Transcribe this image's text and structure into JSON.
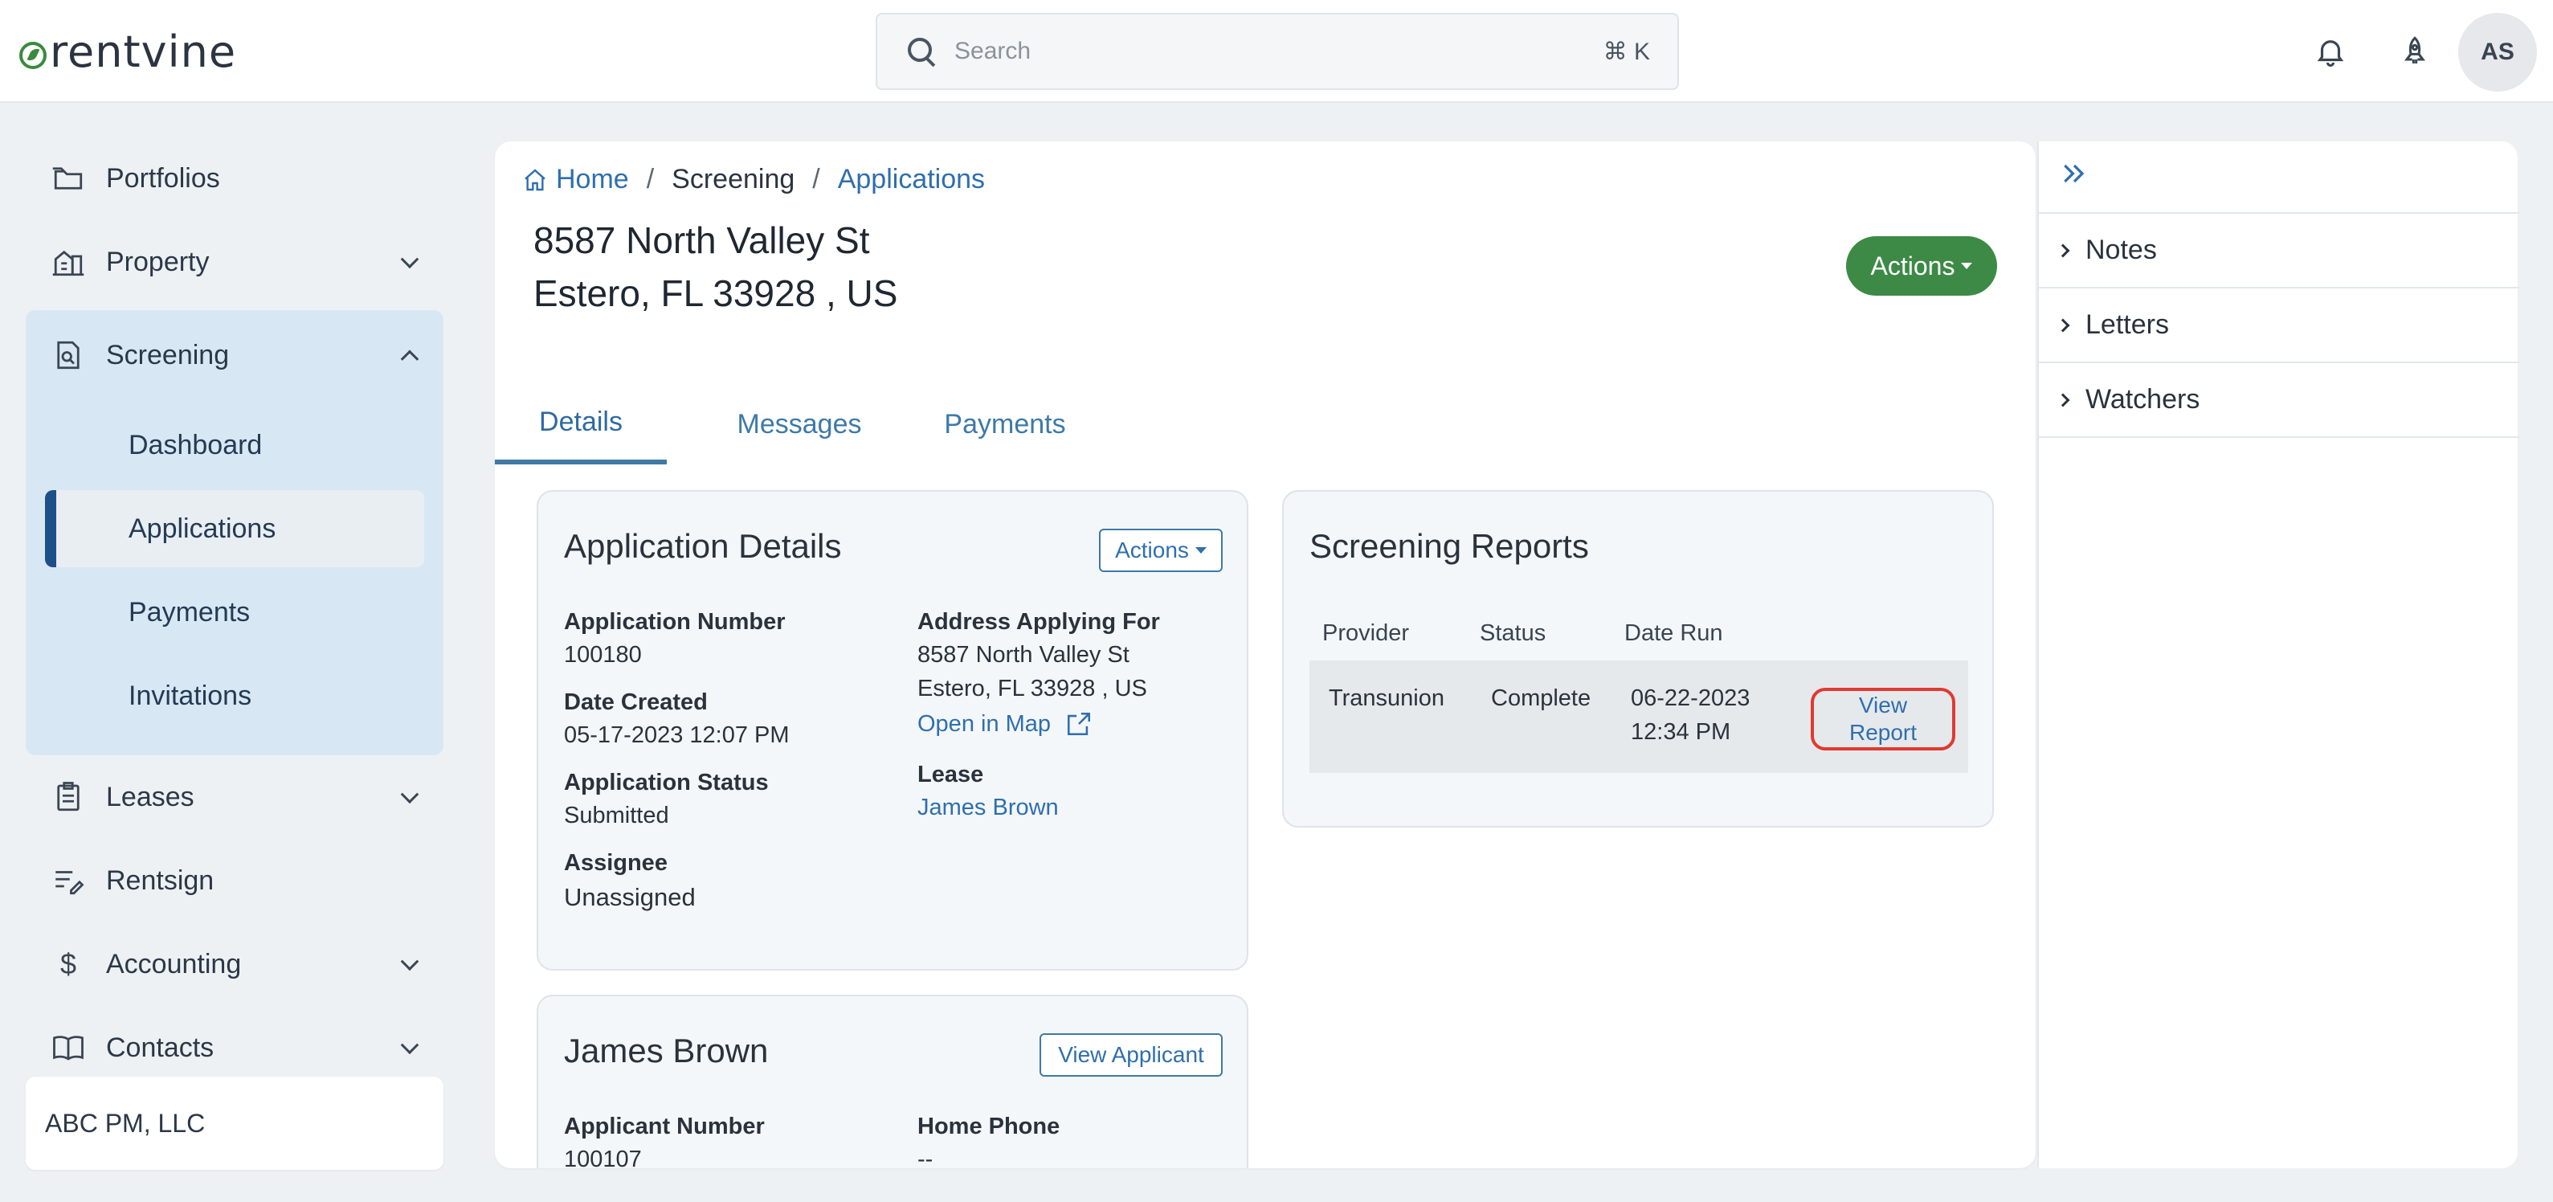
{
  "brand": {
    "logo_text": "rentvine",
    "accent": "#3c8a45"
  },
  "search": {
    "placeholder": "Search",
    "shortcut": "⌘ K"
  },
  "user": {
    "initials": "AS"
  },
  "sidebar": {
    "items": [
      {
        "label": "Portfolios"
      },
      {
        "label": "Property"
      },
      {
        "label": "Screening"
      },
      {
        "label": "Leases"
      },
      {
        "label": "Rentsign"
      },
      {
        "label": "Accounting"
      },
      {
        "label": "Contacts"
      }
    ],
    "screening_sub": [
      {
        "label": "Dashboard"
      },
      {
        "label": "Applications"
      },
      {
        "label": "Payments"
      },
      {
        "label": "Invitations"
      }
    ],
    "org": "ABC PM, LLC"
  },
  "breadcrumb": {
    "home": "Home",
    "sep": "/",
    "middle": "Screening",
    "current": "Applications"
  },
  "page": {
    "title_line1": "8587 North Valley St",
    "title_line2": "Estero, FL 33928 , US",
    "actions_label": "Actions"
  },
  "tabs": [
    {
      "label": "Details"
    },
    {
      "label": "Messages"
    },
    {
      "label": "Payments"
    }
  ],
  "application_details": {
    "title": "Application Details",
    "actions_label": "Actions",
    "application_number_label": "Application Number",
    "application_number": "100180",
    "date_created_label": "Date Created",
    "date_created": "05-17-2023 12:07 PM",
    "status_label": "Application Status",
    "status": "Submitted",
    "assignee_label": "Assignee",
    "assignee": "Unassigned",
    "address_label": "Address Applying For",
    "address_line1": "8587 North Valley St",
    "address_line2": "Estero, FL 33928 , US",
    "open_map": "Open in Map",
    "lease_label": "Lease",
    "lease": "James Brown"
  },
  "screening_reports": {
    "title": "Screening Reports",
    "headers": {
      "provider": "Provider",
      "status": "Status",
      "date_run": "Date Run"
    },
    "rows": [
      {
        "provider": "Transunion",
        "status": "Complete",
        "date_line1": "06-22-2023",
        "date_line2": "12:34 PM",
        "action_line1": "View",
        "action_line2": "Report"
      }
    ]
  },
  "applicant": {
    "name": "James Brown",
    "view_label": "View Applicant",
    "number_label": "Applicant Number",
    "number": "100107",
    "home_phone_label": "Home Phone",
    "home_phone": "--"
  },
  "right_panel": {
    "items": [
      {
        "label": "Notes"
      },
      {
        "label": "Letters"
      },
      {
        "label": "Watchers"
      }
    ]
  }
}
